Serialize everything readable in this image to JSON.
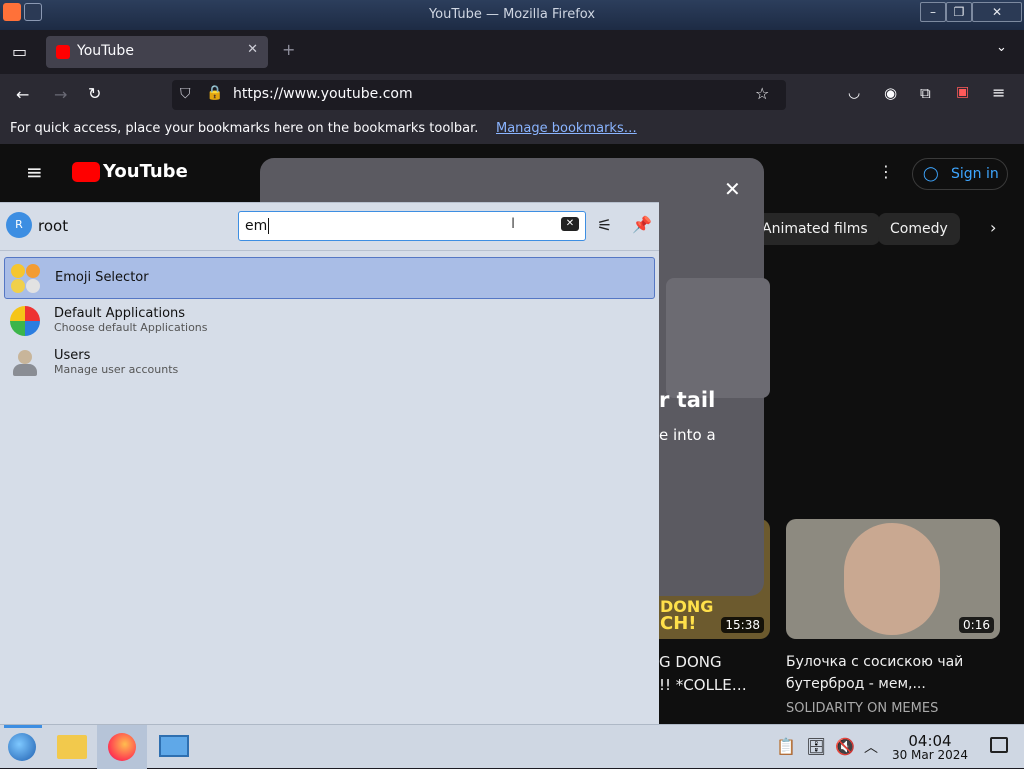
{
  "window": {
    "title": "YouTube — Mozilla Firefox"
  },
  "browser": {
    "tab_title": "YouTube",
    "url": "https://www.youtube.com",
    "bookmarks_msg": "For quick access, place your bookmarks here on the bookmarks toolbar.",
    "bookmarks_link": "Manage bookmarks…"
  },
  "youtube": {
    "logo": "YouTube",
    "sign_in": "Sign in",
    "chips": [
      "Animated films",
      "Comedy"
    ],
    "modal_heading_fragment": "r tail",
    "modal_body_fragment": "e into a",
    "video1": {
      "title1": "G DONG",
      "title2": "!! *COLLE…",
      "duration": "15:38",
      "thumb_text1": "DONG",
      "thumb_text2": "CH!"
    },
    "video2": {
      "title1": "Булочка с сосискою чай",
      "title2": "бутерброд - мем,...",
      "channel": "SOLIDARITY ON MEMES",
      "duration": "0:16"
    }
  },
  "launcher": {
    "user": "root",
    "avatar_initial": "R",
    "search_value": "em",
    "results": [
      {
        "title": "Emoji Selector",
        "subtitle": ""
      },
      {
        "title": "Default Applications",
        "subtitle": "Choose default Applications"
      },
      {
        "title": "Users",
        "subtitle": "Manage user accounts"
      }
    ]
  },
  "taskbar": {
    "time": "04:04",
    "date": "30 Mar 2024"
  },
  "colors": {
    "accent": "#3d8ee2",
    "selected": "#a9bde6",
    "youtube_red": "#ff0000"
  }
}
